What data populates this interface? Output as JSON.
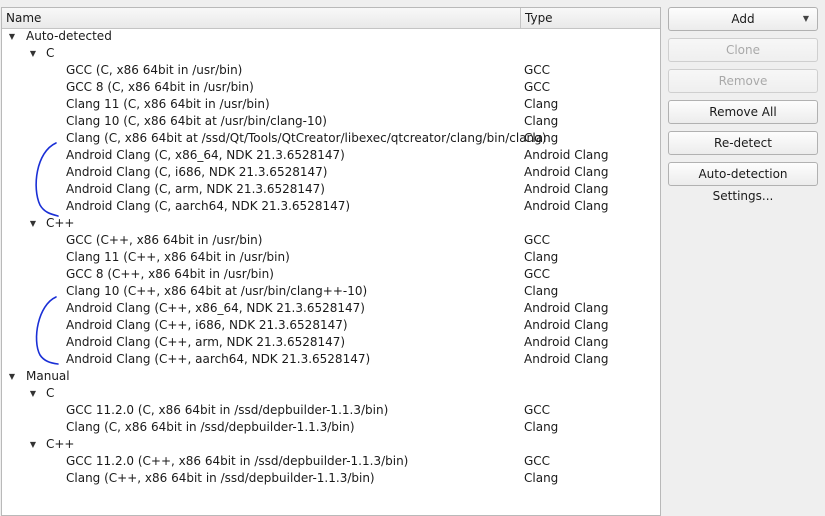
{
  "header": {
    "name": "Name",
    "type": "Type"
  },
  "rows": [
    {
      "level": 0,
      "expanded": true,
      "label": "Auto-detected",
      "type": ""
    },
    {
      "level": 1,
      "expanded": true,
      "label": "C",
      "type": ""
    },
    {
      "level": 2,
      "label": "GCC (C, x86 64bit in /usr/bin)",
      "type": "GCC"
    },
    {
      "level": 2,
      "label": "GCC 8 (C, x86 64bit in /usr/bin)",
      "type": "GCC"
    },
    {
      "level": 2,
      "label": "Clang 11 (C, x86 64bit in /usr/bin)",
      "type": "Clang"
    },
    {
      "level": 2,
      "label": "Clang 10 (C, x86 64bit at /usr/bin/clang-10)",
      "type": "Clang"
    },
    {
      "level": 2,
      "label": "Clang (C, x86 64bit at /ssd/Qt/Tools/QtCreator/libexec/qtcreator/clang/bin/clang)",
      "type": "Clang"
    },
    {
      "level": 2,
      "label": "Android Clang (C, x86_64, NDK 21.3.6528147)",
      "type": "Android Clang"
    },
    {
      "level": 2,
      "label": "Android Clang (C, i686, NDK 21.3.6528147)",
      "type": "Android Clang"
    },
    {
      "level": 2,
      "label": "Android Clang (C, arm, NDK 21.3.6528147)",
      "type": "Android Clang"
    },
    {
      "level": 2,
      "label": "Android Clang (C, aarch64, NDK 21.3.6528147)",
      "type": "Android Clang"
    },
    {
      "level": 1,
      "expanded": true,
      "label": "C++",
      "type": ""
    },
    {
      "level": 2,
      "label": "GCC (C++, x86 64bit in /usr/bin)",
      "type": "GCC"
    },
    {
      "level": 2,
      "label": "Clang 11 (C++, x86 64bit in /usr/bin)",
      "type": "Clang"
    },
    {
      "level": 2,
      "label": "GCC 8 (C++, x86 64bit in /usr/bin)",
      "type": "GCC"
    },
    {
      "level": 2,
      "label": "Clang 10 (C++, x86 64bit at /usr/bin/clang++-10)",
      "type": "Clang"
    },
    {
      "level": 2,
      "label": "Android Clang (C++, x86_64, NDK 21.3.6528147)",
      "type": "Android Clang"
    },
    {
      "level": 2,
      "label": "Android Clang (C++, i686, NDK 21.3.6528147)",
      "type": "Android Clang"
    },
    {
      "level": 2,
      "label": "Android Clang (C++, arm, NDK 21.3.6528147)",
      "type": "Android Clang"
    },
    {
      "level": 2,
      "label": "Android Clang (C++, aarch64, NDK 21.3.6528147)",
      "type": "Android Clang"
    },
    {
      "level": 0,
      "expanded": true,
      "label": "Manual",
      "type": ""
    },
    {
      "level": 1,
      "expanded": true,
      "label": "C",
      "type": ""
    },
    {
      "level": 2,
      "label": "GCC 11.2.0 (C, x86 64bit in /ssd/depbuilder-1.1.3/bin)",
      "type": "GCC"
    },
    {
      "level": 2,
      "label": "Clang (C, x86 64bit in /ssd/depbuilder-1.1.3/bin)",
      "type": "Clang"
    },
    {
      "level": 1,
      "expanded": true,
      "label": "C++",
      "type": ""
    },
    {
      "level": 2,
      "label": "GCC 11.2.0 (C++, x86 64bit in /ssd/depbuilder-1.1.3/bin)",
      "type": "GCC"
    },
    {
      "level": 2,
      "label": "Clang (C++, x86 64bit in /ssd/depbuilder-1.1.3/bin)",
      "type": "Clang"
    }
  ],
  "buttons": {
    "add": "Add",
    "clone": "Clone",
    "remove": "Remove",
    "remove_all": "Remove All",
    "redetect": "Re-detect",
    "autodetect_settings": "Auto-detection Settings..."
  },
  "icons": {
    "expanded_arrow": "chevron-down-icon",
    "dropdown_arrow": "caret-down-icon"
  },
  "colors": {
    "annotation_ink": "#1a2fd6",
    "disabled_text": "#a9a9a9"
  }
}
